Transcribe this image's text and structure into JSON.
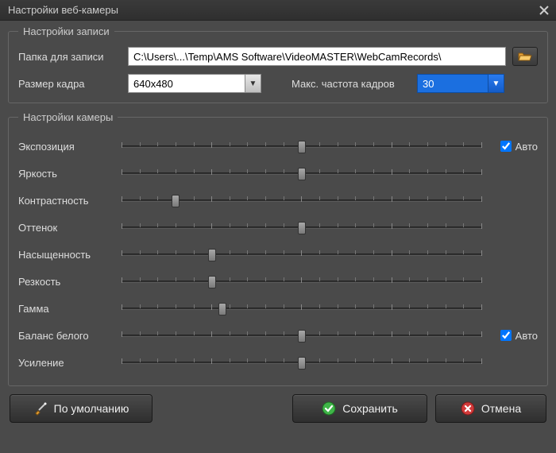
{
  "window": {
    "title": "Настройки веб-камеры"
  },
  "recording": {
    "legend": "Настройки записи",
    "folder_label": "Папка для записи",
    "folder_value": "C:\\Users\\...\\Temp\\AMS Software\\VideoMASTER\\WebCamRecords\\",
    "frame_size_label": "Размер кадра",
    "frame_size_value": "640x480",
    "fps_label": "Макс. частота кадров",
    "fps_value": "30"
  },
  "camera": {
    "legend": "Настройки камеры",
    "auto_label": "Авто",
    "sliders": [
      {
        "label": "Экспозиция",
        "pos": 50,
        "auto": true,
        "auto_checked": true
      },
      {
        "label": "Яркость",
        "pos": 50,
        "auto": false
      },
      {
        "label": "Контрастность",
        "pos": 15,
        "auto": false
      },
      {
        "label": "Оттенок",
        "pos": 50,
        "auto": false
      },
      {
        "label": "Насыщенность",
        "pos": 25,
        "auto": false
      },
      {
        "label": "Резкость",
        "pos": 25,
        "auto": false
      },
      {
        "label": "Гамма",
        "pos": 28,
        "auto": false
      },
      {
        "label": "Баланс белого",
        "pos": 50,
        "auto": true,
        "auto_checked": true
      },
      {
        "label": "Усиление",
        "pos": 50,
        "auto": false
      }
    ]
  },
  "buttons": {
    "defaults": "По умолчанию",
    "save": "Сохранить",
    "cancel": "Отмена"
  }
}
